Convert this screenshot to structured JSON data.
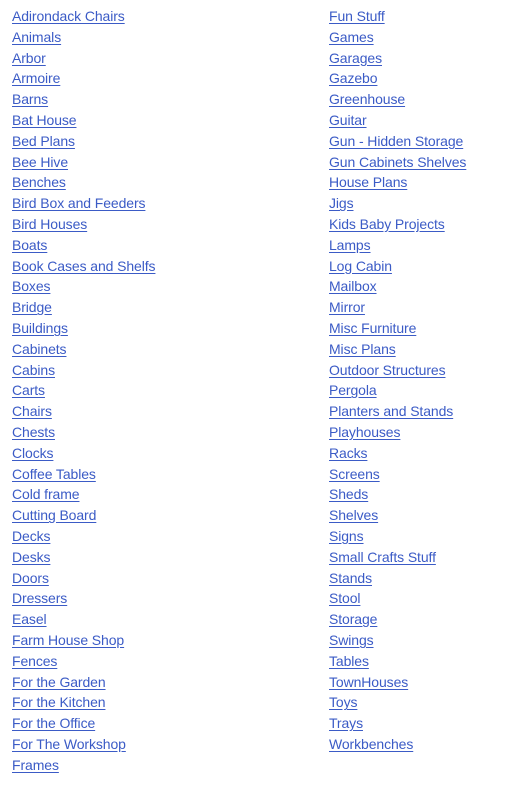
{
  "colors": {
    "link": "#3b5bc6",
    "background": "#ffffff"
  },
  "categories": {
    "left": [
      "Adirondack Chairs",
      "Animals",
      "Arbor",
      "Armoire",
      "Barns",
      "Bat House",
      "Bed Plans",
      "Bee Hive",
      "Benches",
      "Bird Box and Feeders",
      "Bird Houses",
      "Boats",
      "Book Cases and Shelfs",
      "Boxes",
      "Bridge",
      "Buildings",
      "Cabinets",
      "Cabins",
      "Carts",
      "Chairs",
      "Chests",
      "Clocks",
      "Coffee Tables",
      "Cold frame",
      "Cutting Board",
      "Decks",
      "Desks",
      "Doors",
      "Dressers",
      "Easel",
      "Farm House Shop",
      "Fences",
      "For the Garden",
      "For the Kitchen",
      "For the Office",
      "For The Workshop",
      "Frames"
    ],
    "right": [
      "Fun Stuff",
      "Games",
      "Garages",
      "Gazebo",
      "Greenhouse",
      "Guitar",
      "Gun - Hidden Storage",
      "Gun Cabinets Shelves",
      "House Plans",
      "Jigs",
      "Kids Baby Projects",
      "Lamps",
      "Log Cabin",
      "Mailbox",
      "Mirror",
      "Misc Furniture",
      "Misc Plans",
      "Outdoor Structures",
      "Pergola",
      "Planters and Stands",
      "Playhouses",
      "Racks",
      "Screens",
      "Sheds",
      "Shelves",
      "Signs",
      "Small Crafts Stuff",
      "Stands",
      "Stool",
      "Storage",
      "Swings",
      "Tables",
      "TownHouses",
      "Toys",
      "Trays",
      "Workbenches"
    ]
  }
}
